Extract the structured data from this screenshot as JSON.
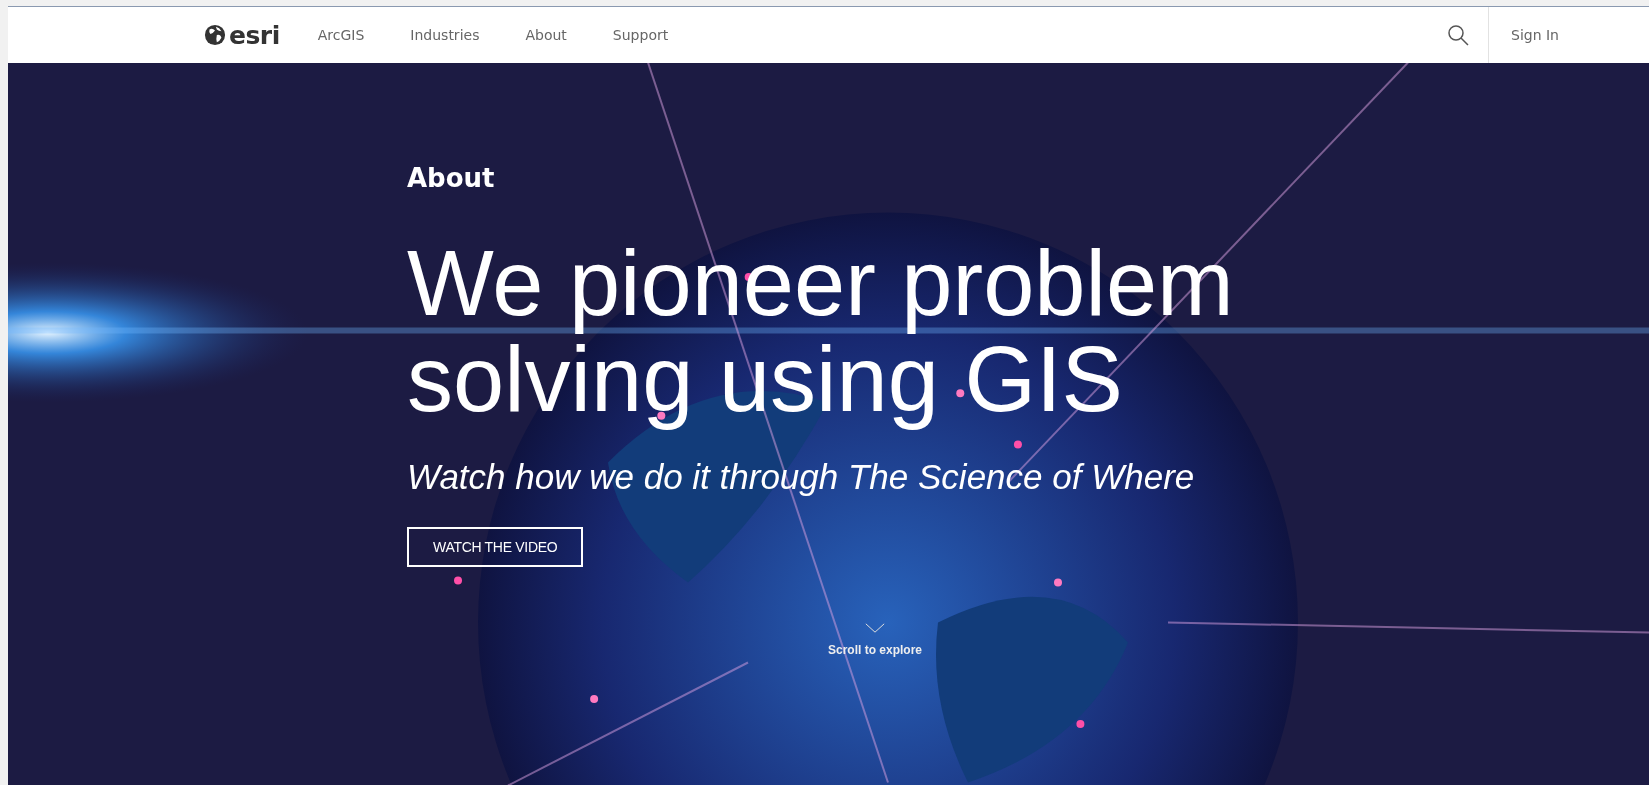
{
  "nav": {
    "logo": "esri",
    "items": [
      {
        "label": "ArcGIS"
      },
      {
        "label": "Industries"
      },
      {
        "label": "About"
      },
      {
        "label": "Support"
      }
    ],
    "sign_in": "Sign In"
  },
  "hero": {
    "eyebrow": "About",
    "headline": "We pioneer problem solving using GIS",
    "subtitle": "Watch how we do it through The Science of Where",
    "button": "WATCH THE VIDEO",
    "scroll_label": "Scroll to explore"
  }
}
